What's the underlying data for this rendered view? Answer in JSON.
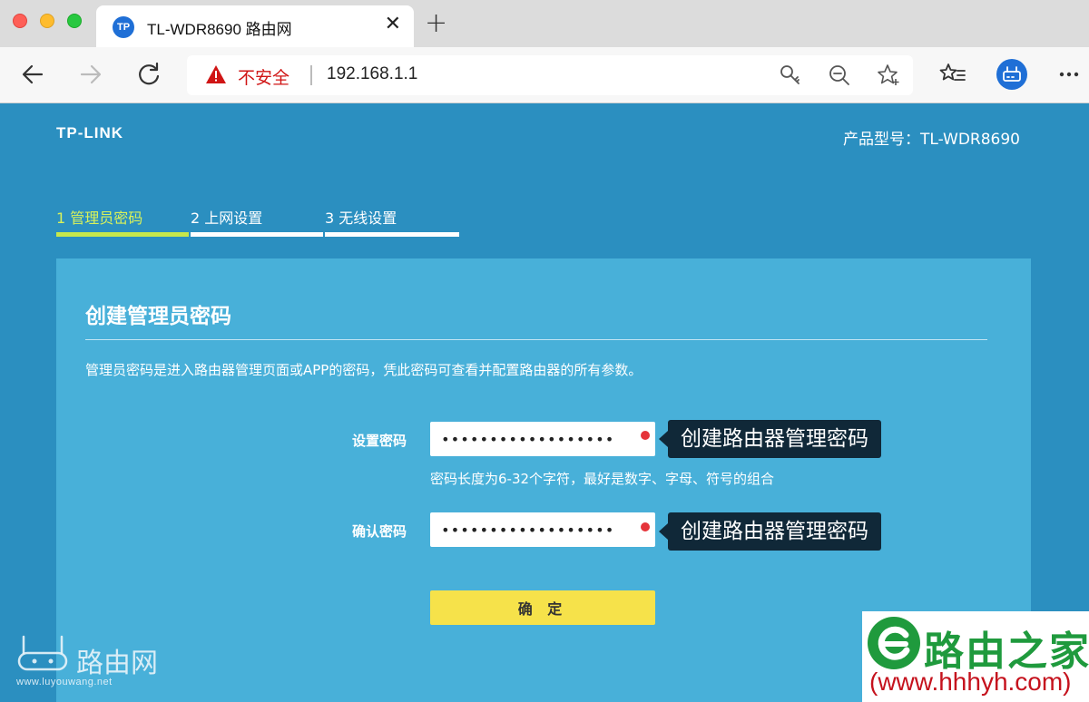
{
  "browser": {
    "tab_title": "TL-WDR8690 路由网",
    "tab_favicon": "TP",
    "security_label": "不安全",
    "url": "192.168.1.1",
    "icons": [
      "back-icon",
      "forward-icon",
      "reload-icon",
      "warning-icon",
      "key-icon",
      "zoom-out-icon",
      "star-icon",
      "favorites-icon",
      "profile-icon",
      "more-icon"
    ]
  },
  "header": {
    "brand": "TP-LINK",
    "model": "产品型号：TL-WDR8690"
  },
  "steps": [
    {
      "label": "1 管理员密码",
      "active": true
    },
    {
      "label": "2 上网设置",
      "active": false
    },
    {
      "label": "3 无线设置",
      "active": false
    }
  ],
  "form": {
    "title": "创建管理员密码",
    "description": "管理员密码是进入路由器管理页面或APP的密码，凭此密码可查看并配置路由器的所有参数。",
    "password_label": "设置密码",
    "password_value": "••••••••••••••••••",
    "password_hint": "密码长度为6-32个字符，最好是数字、字母、符号的组合",
    "confirm_label": "确认密码",
    "confirm_value": "••••••••••••••••••",
    "submit_label": "确 定"
  },
  "annotations": {
    "password_tip": "创建路由器管理密码",
    "confirm_tip": "创建路由器管理密码"
  },
  "watermarks": {
    "left_text": "路由网",
    "left_url": "www.luyouwang.net",
    "right_text": "路由之家",
    "right_url": "(www.hhhyh.com)"
  },
  "colors": {
    "page_bg": "#2b8fc0",
    "card_bg": "#48b0d9",
    "active_step": "#c6e84b",
    "submit_button": "#f6e24a",
    "required_dot": "#e5343a",
    "insecure_text": "#d01515"
  }
}
